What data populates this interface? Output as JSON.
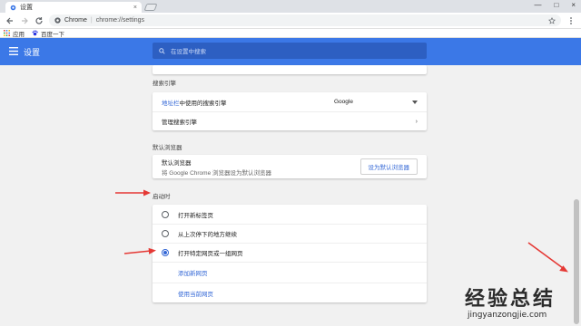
{
  "tab": {
    "title": "设置",
    "close": "×"
  },
  "window_controls": [
    "—",
    "□",
    "×"
  ],
  "toolbar": {
    "site_label": "Chrome",
    "separator": "|",
    "url": "chrome://settings"
  },
  "bookmarks": [
    {
      "label": "应用",
      "icon": "apps-grid-icon"
    },
    {
      "label": "百度一下",
      "icon": "baidu-paw-icon"
    }
  ],
  "header": {
    "title": "设置",
    "search_placeholder": "在设置中搜索"
  },
  "search_engine": {
    "heading": "搜索引擎",
    "row1_link": "地址栏",
    "row1_text": "中使用的搜索引擎",
    "row1_value": "Google",
    "row2_label": "管理搜索引擎"
  },
  "default_browser": {
    "heading": "默认浏览器",
    "title": "默认浏览器",
    "subtitle": "将 Google Chrome 浏览器设为默认浏览器",
    "button": "设为默认浏览器"
  },
  "startup": {
    "heading": "启动时",
    "options": [
      {
        "label": "打开新标签页",
        "selected": false
      },
      {
        "label": "从上次停下的地方继续",
        "selected": false
      },
      {
        "label": "打开特定网页或一组网页",
        "selected": true
      }
    ],
    "links": [
      "添加新网页",
      "使用当前网页"
    ]
  },
  "watermark": {
    "title": "经验总结",
    "url": "jingyanzongjie.com"
  },
  "colors": {
    "header": "#3b78e7",
    "link": "#3367d6",
    "arrow": "#e53935"
  }
}
